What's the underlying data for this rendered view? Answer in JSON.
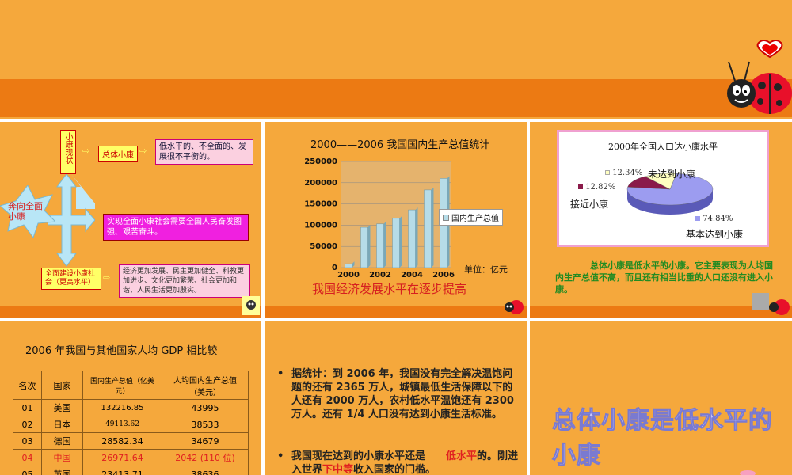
{
  "slide1": {
    "current_label": "小康现状",
    "general_label": "总体小康",
    "general_desc": "低水平的、不全面的、发展很不平衡的。",
    "toward_label": "奔向全面小康",
    "realize_text": "实现全面小康社会需要全国人民奋发图强、艰苦奋斗。",
    "build_label": "全面建设小康社会（更高水平）",
    "build_desc": "经济更加发展、民主更加健全、科教更加进步、文化更加繁荣、社会更加和谐、人民生活更加殷实。"
  },
  "slide2": {
    "title": "2000——2006 我国国内生产总值统计",
    "legend": "国内生产总值",
    "unit": "单位：亿元",
    "caption": "我国经济发展水平在逐步提高",
    "chart_data": {
      "type": "bar",
      "categories": [
        "2000",
        "2001",
        "2002",
        "2003",
        "2004",
        "2005",
        "2006"
      ],
      "x_tick_labels": [
        "2000",
        "2002",
        "2004",
        "2006"
      ],
      "series": [
        {
          "name": "国内生产总值",
          "values": [
            9000,
            95000,
            103000,
            116000,
            136000,
            183000,
            210000
          ]
        }
      ],
      "y_ticks": [
        "0",
        "50000",
        "100000",
        "150000",
        "200000",
        "250000"
      ],
      "ylim": [
        0,
        250000
      ],
      "color": "#b6dce8"
    }
  },
  "slide3": {
    "title": "2000年全国人口达小康水平",
    "caption": "总体小康是低水平的小康。它主要表现为人均国内生产总值不高，而且还有相当比重的人口还没有进入小康。",
    "chart_data": {
      "type": "pie",
      "title": "2000年全国人口达小康水平",
      "labels": [
        "基本达到小康",
        "接近小康",
        "未达到小康"
      ],
      "values": [
        74.84,
        12.82,
        12.34
      ],
      "value_labels": [
        "74.84%",
        "12.82%",
        "12.34%"
      ],
      "colors": [
        "#9c9cf0",
        "#8a1a4a",
        "#ffffc0"
      ]
    }
  },
  "slide4": {
    "title": "2006 年我国与其他国家人均 GDP 相比较",
    "headers": [
      "名次",
      "国家",
      "国内生产总值（亿美元）",
      "人均国内生产总值（美元）"
    ],
    "rows": [
      [
        "01",
        "美国",
        "132216.85",
        "43995"
      ],
      [
        "02",
        "日本",
        "49113.62",
        "38533"
      ],
      [
        "03",
        "德国",
        "28582.34",
        "34679"
      ],
      [
        "04",
        "中国",
        "26971.64",
        "2042 (110 位)"
      ],
      [
        "05",
        "英国",
        "23413.71",
        "38636"
      ]
    ]
  },
  "slide5": {
    "bullet1": "据统计：到 2006 年，我国没有完全解决温饱问题的还有 2365 万人，城镇最低生活保障以下的人还有 2000 万人，农村低水平温饱还有 2300 万人。还有 1/4 人口没有达到小康生活标准。",
    "bullet2_a": "我国现在达到的小康水平还是",
    "bullet2_red": "低水平",
    "bullet2_b": "的。刚进入世界",
    "bullet2_red2": "下中等",
    "bullet2_c": "收入国家的门槛。"
  },
  "slide6": {
    "big_title": "总体小康是低水平的小康"
  }
}
